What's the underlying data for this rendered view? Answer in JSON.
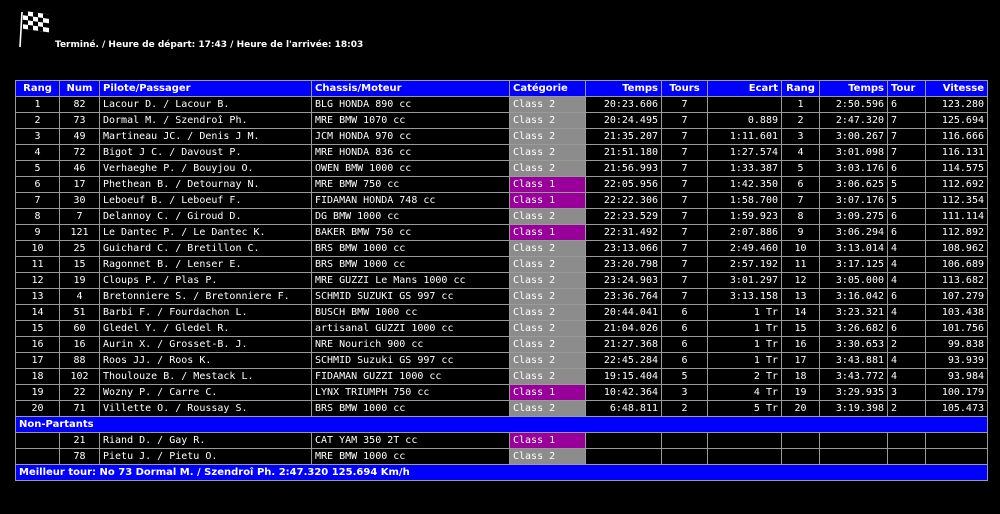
{
  "header": {
    "flag_icon": "checkered-flag-icon",
    "status": "Terminé. / Heure de départ: 17:43 / Heure de l'arrivée: 18:03"
  },
  "colors": {
    "header_bg": "#0000ff",
    "class2": "#8c8c8c",
    "class1": "#990099"
  },
  "columns": {
    "rang": "Rang",
    "num": "Num",
    "pilote": "Pilote/Passager",
    "chassis": "Chassis/Moteur",
    "categorie": "Catégorie",
    "temps": "Temps",
    "tours": "Tours",
    "ecart": "Ecart",
    "rang2": "Rang",
    "temps2": "Temps",
    "tour": "Tour",
    "vitesse": "Vitesse"
  },
  "rows": [
    {
      "rang": "1",
      "num": "82",
      "pilote": "Lacour D. / Lacour B.",
      "chassis": "BLG HONDA 890 cc",
      "cat": "Class 2",
      "temps": "20:23.606",
      "tours": "7",
      "ecart": "",
      "rang2": "1",
      "temps2": "2:50.596",
      "tour": "6",
      "vitesse": "123.280"
    },
    {
      "rang": "2",
      "num": "73",
      "pilote": "Dormal M. / Szendroî Ph.",
      "chassis": "MRE BMW 1070 cc",
      "cat": "Class 2",
      "temps": "20:24.495",
      "tours": "7",
      "ecart": "0.889",
      "rang2": "2",
      "temps2": "2:47.320",
      "tour": "7",
      "vitesse": "125.694"
    },
    {
      "rang": "3",
      "num": "49",
      "pilote": "Martineau JC. / Denis J M.",
      "chassis": "JCM HONDA 970 cc",
      "cat": "Class 2",
      "temps": "21:35.207",
      "tours": "7",
      "ecart": "1:11.601",
      "rang2": "3",
      "temps2": "3:00.267",
      "tour": "7",
      "vitesse": "116.666"
    },
    {
      "rang": "4",
      "num": "72",
      "pilote": "Bigot J C. / Davoust P.",
      "chassis": "MRE HONDA 836 cc",
      "cat": "Class 2",
      "temps": "21:51.180",
      "tours": "7",
      "ecart": "1:27.574",
      "rang2": "4",
      "temps2": "3:01.098",
      "tour": "7",
      "vitesse": "116.131"
    },
    {
      "rang": "5",
      "num": "46",
      "pilote": "Verhaeghe P. / Bouyjou O.",
      "chassis": "OWEN BMW 1000 cc",
      "cat": "Class 2",
      "temps": "21:56.993",
      "tours": "7",
      "ecart": "1:33.387",
      "rang2": "5",
      "temps2": "3:03.176",
      "tour": "6",
      "vitesse": "114.575"
    },
    {
      "rang": "6",
      "num": "17",
      "pilote": "Phethean B. / Detournay N.",
      "chassis": "MRE BMW 750 cc",
      "cat": "Class 1",
      "temps": "22:05.956",
      "tours": "7",
      "ecart": "1:42.350",
      "rang2": "6",
      "temps2": "3:06.625",
      "tour": "5",
      "vitesse": "112.692"
    },
    {
      "rang": "7",
      "num": "30",
      "pilote": "Leboeuf B. / Leboeuf F.",
      "chassis": "FIDAMAN HONDA 748 cc",
      "cat": "Class 1",
      "temps": "22:22.306",
      "tours": "7",
      "ecart": "1:58.700",
      "rang2": "7",
      "temps2": "3:07.176",
      "tour": "5",
      "vitesse": "112.354"
    },
    {
      "rang": "8",
      "num": "7",
      "pilote": "Delannoy C. / Giroud D.",
      "chassis": "DG BMW 1000 cc",
      "cat": "Class 2",
      "temps": "22:23.529",
      "tours": "7",
      "ecart": "1:59.923",
      "rang2": "8",
      "temps2": "3:09.275",
      "tour": "6",
      "vitesse": "111.114"
    },
    {
      "rang": "9",
      "num": "121",
      "pilote": "Le Dantec P. / Le Dantec K.",
      "chassis": "BAKER BMW 750 cc",
      "cat": "Class 1",
      "temps": "22:31.492",
      "tours": "7",
      "ecart": "2:07.886",
      "rang2": "9",
      "temps2": "3:06.294",
      "tour": "6",
      "vitesse": "112.892"
    },
    {
      "rang": "10",
      "num": "25",
      "pilote": "Guichard C. / Bretillon C.",
      "chassis": "BRS BMW 1000 cc",
      "cat": "Class 2",
      "temps": "23:13.066",
      "tours": "7",
      "ecart": "2:49.460",
      "rang2": "10",
      "temps2": "3:13.014",
      "tour": "4",
      "vitesse": "108.962"
    },
    {
      "rang": "11",
      "num": "15",
      "pilote": "Ragonnet B. / Lenser E.",
      "chassis": "BRS BMW 1000 cc",
      "cat": "Class 2",
      "temps": "23:20.798",
      "tours": "7",
      "ecart": "2:57.192",
      "rang2": "11",
      "temps2": "3:17.125",
      "tour": "4",
      "vitesse": "106.689"
    },
    {
      "rang": "12",
      "num": "19",
      "pilote": "Cloups P. / Plas P.",
      "chassis": "MRE GUZZI Le Mans 1000 cc",
      "cat": "Class 2",
      "temps": "23:24.903",
      "tours": "7",
      "ecart": "3:01.297",
      "rang2": "12",
      "temps2": "3:05.000",
      "tour": "4",
      "vitesse": "113.682"
    },
    {
      "rang": "13",
      "num": "4",
      "pilote": "Bretonniere S. / Bretonniere F.",
      "chassis": "SCHMID SUZUKI GS 997 cc",
      "cat": "Class 2",
      "temps": "23:36.764",
      "tours": "7",
      "ecart": "3:13.158",
      "rang2": "13",
      "temps2": "3:16.042",
      "tour": "6",
      "vitesse": "107.279"
    },
    {
      "rang": "14",
      "num": "51",
      "pilote": "Barbi F. / Fourdachon L.",
      "chassis": "BUSCH BMW 1000 cc",
      "cat": "Class 2",
      "temps": "20:44.041",
      "tours": "6",
      "ecart": "1 Tr",
      "rang2": "14",
      "temps2": "3:23.321",
      "tour": "4",
      "vitesse": "103.438"
    },
    {
      "rang": "15",
      "num": "60",
      "pilote": "Gledel Y. / Gledel R.",
      "chassis": "artisanal GUZZI 1000 cc",
      "cat": "Class 2",
      "temps": "21:04.026",
      "tours": "6",
      "ecart": "1 Tr",
      "rang2": "15",
      "temps2": "3:26.682",
      "tour": "6",
      "vitesse": "101.756"
    },
    {
      "rang": "16",
      "num": "16",
      "pilote": "Aurin X. / Grosset-B. J.",
      "chassis": "NRE Nourich 900 cc",
      "cat": "Class 2",
      "temps": "21:27.368",
      "tours": "6",
      "ecart": "1 Tr",
      "rang2": "16",
      "temps2": "3:30.653",
      "tour": "2",
      "vitesse": "99.838"
    },
    {
      "rang": "17",
      "num": "88",
      "pilote": "Roos JJ. / Roos K.",
      "chassis": "SCHMID Suzuki GS 997 cc",
      "cat": "Class 2",
      "temps": "22:45.284",
      "tours": "6",
      "ecart": "1 Tr",
      "rang2": "17",
      "temps2": "3:43.881",
      "tour": "4",
      "vitesse": "93.939"
    },
    {
      "rang": "18",
      "num": "102",
      "pilote": "Thoulouze B. / Mestack L.",
      "chassis": "FIDAMAN GUZZI 1000 cc",
      "cat": "Class 2",
      "temps": "19:15.404",
      "tours": "5",
      "ecart": "2 Tr",
      "rang2": "18",
      "temps2": "3:43.772",
      "tour": "4",
      "vitesse": "93.984"
    },
    {
      "rang": "19",
      "num": "22",
      "pilote": "Wozny P. / Carre C.",
      "chassis": "LYNX TRIUMPH 750 cc",
      "cat": "Class 1",
      "temps": "10:42.364",
      "tours": "3",
      "ecart": "4 Tr",
      "rang2": "19",
      "temps2": "3:29.935",
      "tour": "3",
      "vitesse": "100.179"
    },
    {
      "rang": "20",
      "num": "71",
      "pilote": "Villette O. / Roussay S.",
      "chassis": "BRS BMW 1000 cc",
      "cat": "Class 2",
      "temps": "6:48.811",
      "tours": "2",
      "ecart": "5 Tr",
      "rang2": "20",
      "temps2": "3:19.398",
      "tour": "2",
      "vitesse": "105.473"
    }
  ],
  "non_partants": {
    "label": "Non-Partants",
    "rows": [
      {
        "num": "21",
        "pilote": "Riand D. / Gay R.",
        "chassis": "CAT YAM 350 2T cc",
        "cat": "Class 1"
      },
      {
        "num": "78",
        "pilote": "Pietu J. / Pietu O.",
        "chassis": "MRE BMW 1000 cc",
        "cat": "Class 2"
      }
    ]
  },
  "best_lap": "Meilleur tour: No 73 Dormal M. / Szendroî Ph. 2:47.320 125.694 Km/h"
}
